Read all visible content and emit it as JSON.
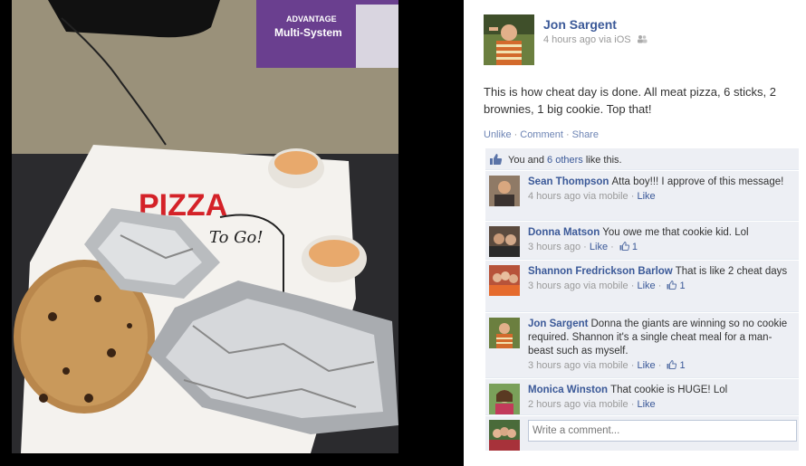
{
  "post": {
    "author": "Jon Sargent",
    "timestamp": "4 hours ago via iOS",
    "audience_icon": "friends-icon",
    "text": "This is how cheat day is done. All meat pizza, 6 sticks, 2 brownies, 1 big cookie. Top that!",
    "actions": {
      "unlike": "Unlike",
      "comment": "Comment",
      "share": "Share",
      "separator": "·"
    }
  },
  "photo": {
    "box_brand_top": "ADVANTAGE",
    "box_brand_main": "Multi-System",
    "pizza_box_logo": "PIZZA",
    "pizza_box_script": "To Go!"
  },
  "likes": {
    "prefix": "You and",
    "link": "6 others",
    "suffix": "like this."
  },
  "comments": [
    {
      "author": "Sean Thompson",
      "text": "Atta boy!!! I approve of this message!",
      "time": "4 hours ago via mobile",
      "like_label": "Like",
      "like_count": ""
    },
    {
      "author": "Donna Matson",
      "text": "You owe me that cookie kid. Lol",
      "time": "3 hours ago",
      "like_label": "Like",
      "like_count": "1"
    },
    {
      "author": "Shannon Fredrickson Barlow",
      "text": "That is like 2 cheat days",
      "time": "3 hours ago via mobile",
      "like_label": "Like",
      "like_count": "1"
    },
    {
      "author": "Jon Sargent",
      "text": "Donna the giants are winning so no cookie required. Shannon it's a single cheat meal for a man-beast such as myself.",
      "time": "3 hours ago via mobile",
      "like_label": "Like",
      "like_count": "1"
    },
    {
      "author": "Monica Winston",
      "text": "That cookie is HUGE! Lol",
      "time": "2 hours ago via mobile",
      "like_label": "Like",
      "like_count": ""
    }
  ],
  "write_comment": {
    "placeholder": "Write a comment..."
  },
  "colors": {
    "link": "#3b5998",
    "muted": "#999999",
    "comment_bg": "#edeff4"
  }
}
